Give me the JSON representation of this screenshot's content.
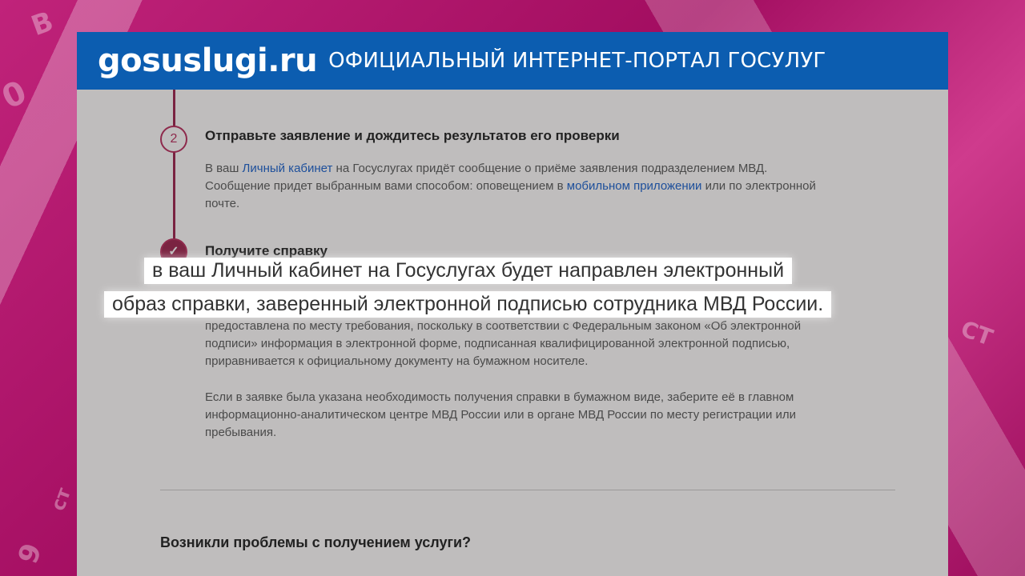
{
  "brand": {
    "logo": "gosuslugi.ru",
    "subtitle": "ОФИЦИАЛЬНЫЙ ИНТЕРНЕТ-ПОРТАЛ ГОСУЛУГ"
  },
  "bg_glyphs": [
    "В",
    "0",
    "ст",
    "9",
    "СТ"
  ],
  "colors": {
    "header": "#0c5db0",
    "accent": "#7a2341",
    "link": "#1d4f9b",
    "background": "#b3146b"
  },
  "step2": {
    "number": "2",
    "title": "Отправьте заявление и дождитесь результатов его проверки",
    "text_1": "В ваш ",
    "link_1": "Личный кабинет",
    "text_2": " на Госуслугах придёт сообщение о приёме заявления подразделением МВД.",
    "text_3": "Сообщение придет выбранным вами способом: оповещением в ",
    "link_2": "мобильном приложении",
    "text_4": " или по электронной",
    "text_5": "почте."
  },
  "step3": {
    "icon": "check-icon",
    "check_glyph": "✓",
    "title": "Получите справку",
    "partial_line": "предоставлена по месту требования, поскольку в соответствии с Федеральным законом «Об электронной",
    "para_1_line_2": "подписи» информация в электронной форме, подписанная квалифицированной электронной подписью,",
    "para_1_line_3": "приравнивается к официальному документу на бумажном носителе.",
    "para_2_line_1": "Если в заявке была указана необходимость получения справки в бумажном виде, заберите её в главном",
    "para_2_line_2": "информационно-аналитическом центре МВД России или в органе МВД России по месту регистрации или",
    "para_2_line_3": "пребывания."
  },
  "problems_heading": "Возникли проблемы с получением услуги?",
  "caption": {
    "line_1": "в ваш Личный кабинет на Госуслугах будет направлен электронный",
    "line_2": "образ справки, заверенный электронной подписью сотрудника МВД России."
  }
}
